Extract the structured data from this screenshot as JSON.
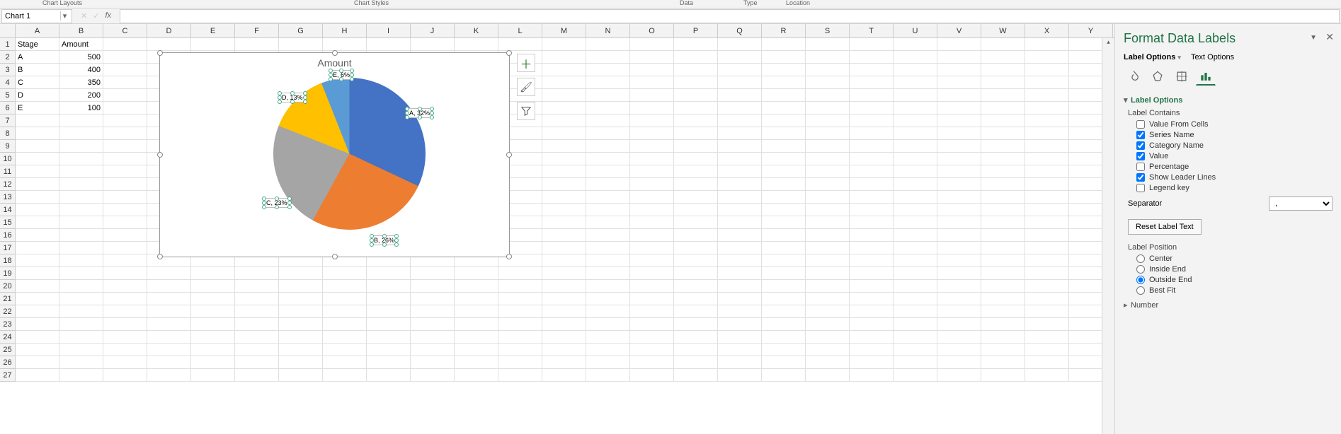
{
  "ribbon": {
    "group_chart_layouts": "Chart Layouts",
    "group_chart_styles": "Chart Styles",
    "group_data": "Data",
    "group_type": "Type",
    "group_location": "Location"
  },
  "namebox": {
    "value": "Chart 1"
  },
  "columns": [
    "A",
    "B",
    "C",
    "D",
    "E",
    "F",
    "G",
    "H",
    "I",
    "J",
    "K",
    "L",
    "M",
    "N",
    "O",
    "P",
    "Q",
    "R",
    "S",
    "T",
    "U",
    "V",
    "W",
    "X",
    "Y"
  ],
  "rows": 27,
  "cells": {
    "A1": "Stage",
    "B1": "Amount",
    "A2": "A",
    "B2": "500",
    "A3": "B",
    "B3": "400",
    "A4": "C",
    "B4": "350",
    "A5": "D",
    "B5": "200",
    "A6": "E",
    "B6": "100"
  },
  "chart": {
    "title": "Amount",
    "labels": {
      "A": "A, 32%",
      "B": "B, 26%",
      "C": "C, 23%",
      "D": "D, 13%",
      "E": "E, 6%"
    }
  },
  "chart_data": {
    "type": "pie",
    "title": "Amount",
    "categories": [
      "A",
      "B",
      "C",
      "D",
      "E"
    ],
    "values": [
      500,
      400,
      350,
      200,
      100
    ],
    "percentages": [
      32,
      26,
      23,
      13,
      6
    ],
    "colors": {
      "A": "#4472C4",
      "B": "#ED7D31",
      "C": "#A5A5A5",
      "D": "#FFC000",
      "E": "#5B9BD5"
    }
  },
  "pane": {
    "title": "Format Data Labels",
    "tab_label_options": "Label Options",
    "tab_text_options": "Text Options",
    "section_label_options": "Label Options",
    "label_contains": "Label Contains",
    "chk_value_from_cells": "Value From Cells",
    "chk_series_name": "Series Name",
    "chk_category_name": "Category Name",
    "chk_value": "Value",
    "chk_percentage": "Percentage",
    "chk_show_leader": "Show Leader Lines",
    "chk_legend_key": "Legend key",
    "separator_label": "Separator",
    "separator_value": ",",
    "reset_btn": "Reset Label Text",
    "label_position": "Label Position",
    "pos_center": "Center",
    "pos_inside_end": "Inside End",
    "pos_outside_end": "Outside End",
    "pos_best_fit": "Best Fit",
    "section_number": "Number"
  }
}
